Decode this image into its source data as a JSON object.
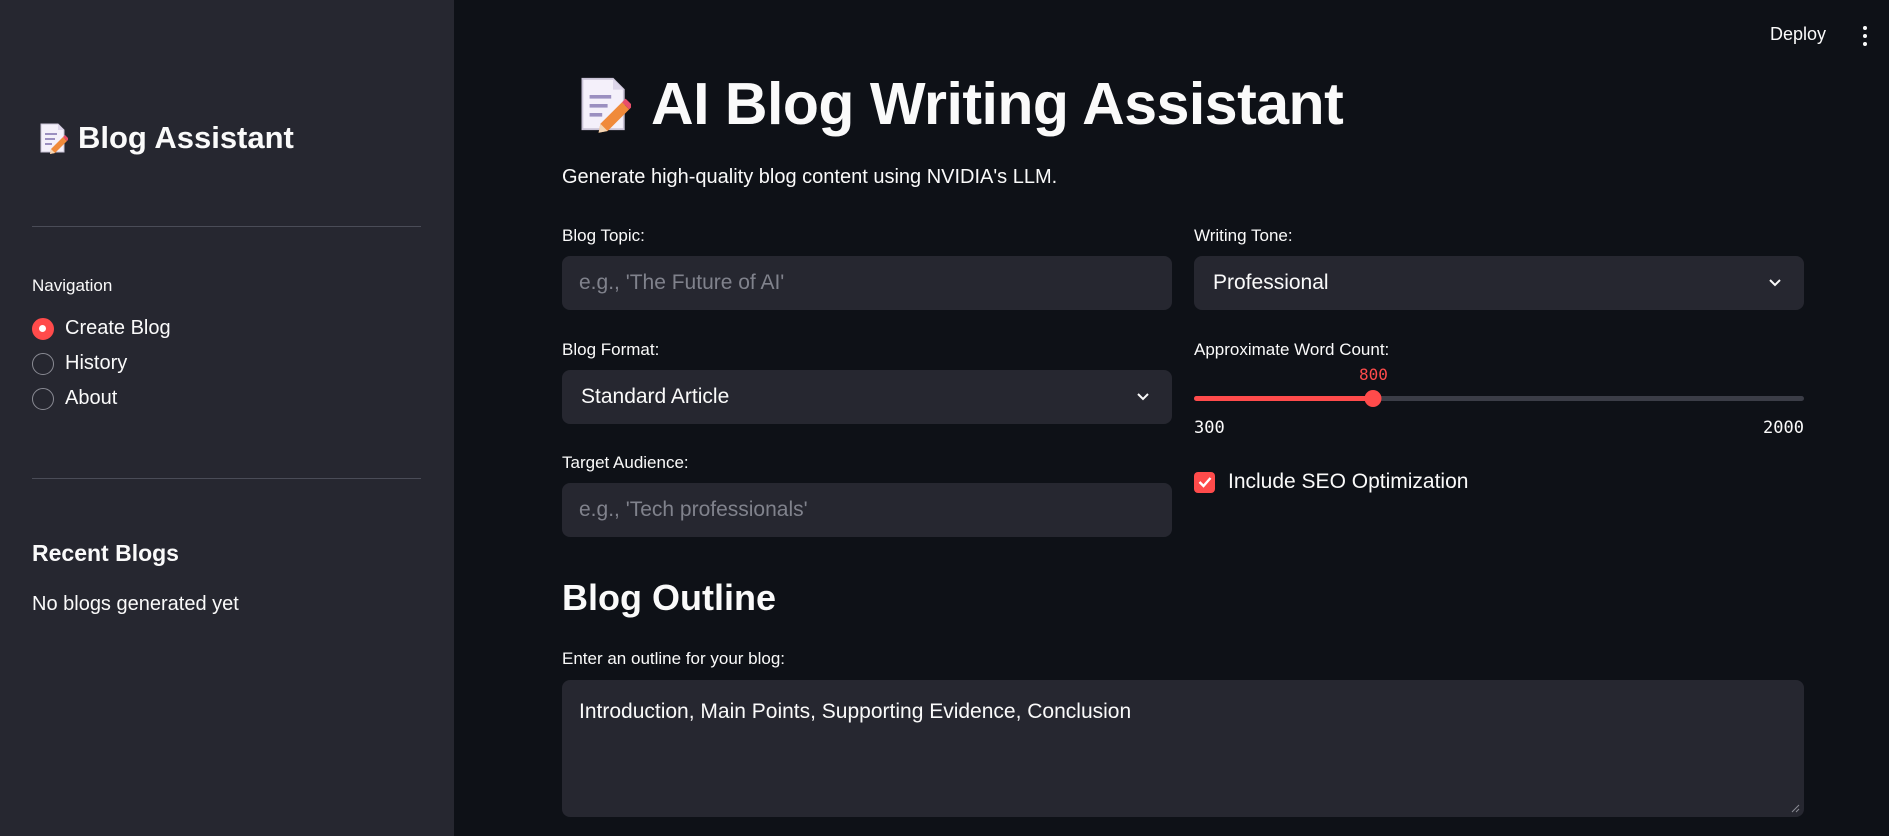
{
  "header": {
    "deploy_label": "Deploy",
    "menu_icon": "vertical-ellipsis-icon"
  },
  "sidebar": {
    "title": "Blog Assistant",
    "title_icon": "memo-icon",
    "nav_label": "Navigation",
    "nav_items": [
      {
        "label": "Create Blog",
        "selected": true
      },
      {
        "label": "History",
        "selected": false
      },
      {
        "label": "About",
        "selected": false
      }
    ],
    "recent_title": "Recent Blogs",
    "recent_empty": "No blogs generated yet"
  },
  "main": {
    "title": "AI Blog Writing Assistant",
    "title_icon": "memo-icon",
    "subtitle": "Generate high-quality blog content using NVIDIA's LLM.",
    "blog_topic": {
      "label": "Blog Topic:",
      "placeholder": "e.g., 'The Future of AI'",
      "value": ""
    },
    "writing_tone": {
      "label": "Writing Tone:",
      "value": "Professional"
    },
    "blog_format": {
      "label": "Blog Format:",
      "value": "Standard Article"
    },
    "word_count": {
      "label": "Approximate Word Count:",
      "value": 800,
      "min": 300,
      "max": 2000
    },
    "target_audience": {
      "label": "Target Audience:",
      "placeholder": "e.g., 'Tech professionals'",
      "value": ""
    },
    "seo": {
      "label": "Include SEO Optimization",
      "checked": true
    },
    "outline_section_title": "Blog Outline",
    "outline": {
      "label": "Enter an outline for your blog:",
      "value": "Introduction, Main Points, Supporting Evidence, Conclusion"
    }
  },
  "colors": {
    "accent": "#ff4b4b",
    "background": "#0e1117",
    "sidebar": "#262730",
    "input": "#262730"
  }
}
